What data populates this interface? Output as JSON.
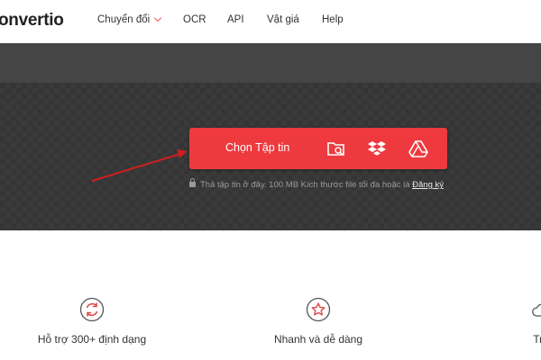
{
  "header": {
    "logo": "onvertio",
    "nav": [
      {
        "label": "Chuyển đổi",
        "dropdown": true
      },
      {
        "label": "OCR"
      },
      {
        "label": "API"
      },
      {
        "label": "Vật giá"
      },
      {
        "label": "Help"
      }
    ]
  },
  "upload": {
    "button_label": "Chọn Tập tin",
    "sources": [
      "folder-search-icon",
      "dropbox-icon",
      "google-drive-icon"
    ],
    "hint_text": "Thả tập tin ở đây. 100 MB Kích thước file tối đa hoặc là",
    "hint_link": "Đăng ký"
  },
  "features": [
    {
      "title": "Hỗ trợ 300+ định dạng",
      "icon": "refresh-icon"
    },
    {
      "title": "Nhanh và dễ dàng",
      "icon": "star-icon"
    },
    {
      "title": "Trê",
      "icon": "cloud-icon"
    }
  ],
  "colors": {
    "accent": "#ee3a3f",
    "header_band": "#454545",
    "hero_bg": "#353535",
    "annotation_arrow": "#cc1f1f"
  }
}
